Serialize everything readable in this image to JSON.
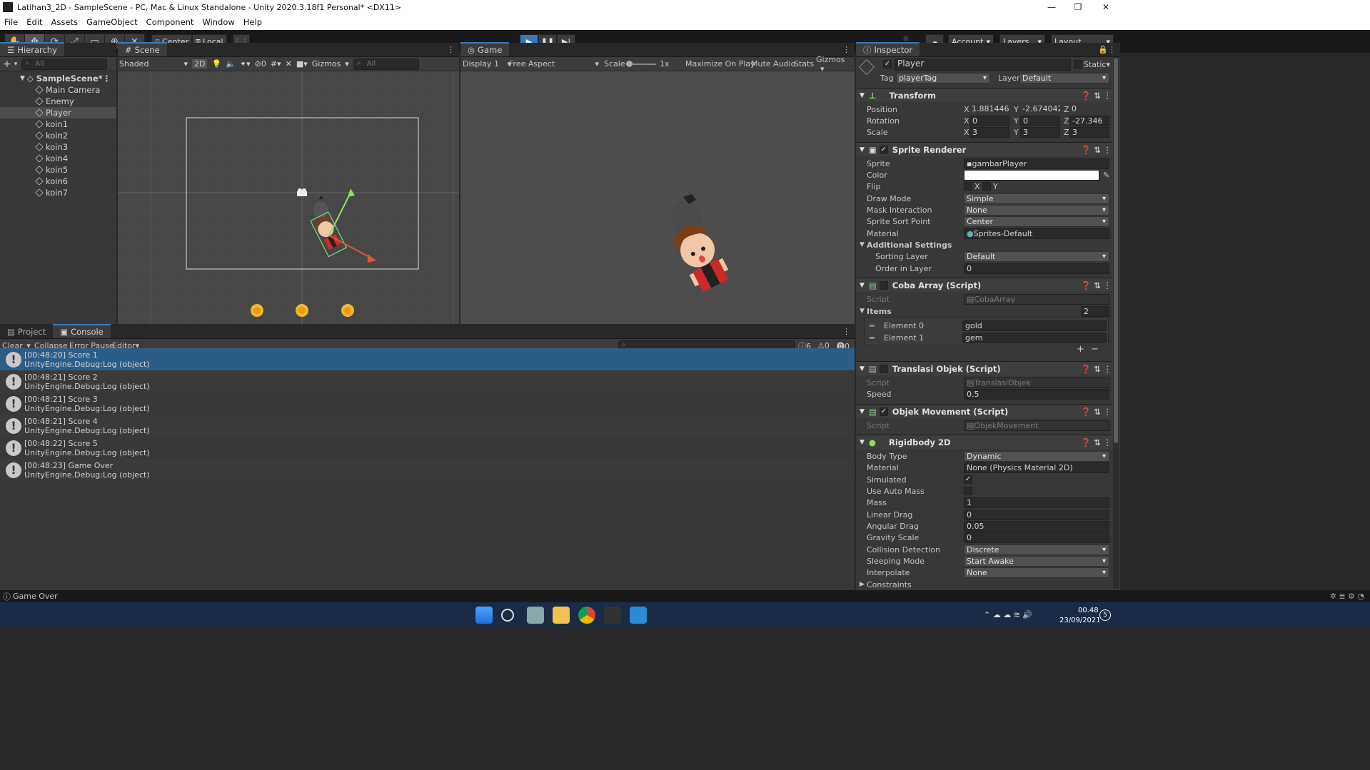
{
  "window": {
    "title": "Latihan3_2D - SampleScene - PC, Mac & Linux Standalone - Unity 2020.3.18f1 Personal* <DX11>",
    "min": "—",
    "max": "❐",
    "close": "✕"
  },
  "menu": [
    "File",
    "Edit",
    "Assets",
    "GameObject",
    "Component",
    "Window",
    "Help"
  ],
  "toolbar": {
    "pivot": "Center",
    "space": "Local",
    "account": "Account",
    "layers": "Layers",
    "layout": "Layout"
  },
  "hierarchy": {
    "tab": "Hierarchy",
    "plus": "+",
    "search": "All",
    "scene": "SampleScene*",
    "items": [
      "Main Camera",
      "Enemy",
      "Player",
      "koin1",
      "koin2",
      "koin3",
      "koin4",
      "koin5",
      "koin6",
      "koin7"
    ],
    "selected": "Player"
  },
  "scene": {
    "tab": "Scene",
    "shading": "Shaded",
    "mode2d": "2D",
    "hidden_count": "0",
    "gizmos": "Gizmos",
    "search": "All"
  },
  "game": {
    "tab": "Game",
    "display": "Display 1",
    "aspect": "Free Aspect",
    "scale_label": "Scale",
    "scale_value": "1x",
    "maximize": "Maximize On Play",
    "mute": "Mute Audio",
    "stats": "Stats",
    "gizmos": "Gizmos"
  },
  "bottom": {
    "tab_project": "Project",
    "tab_console": "Console",
    "clear": "Clear",
    "collapse": "Collapse",
    "error_pause": "Error Pause",
    "editor": "Editor",
    "log_count": "6",
    "warn_count": "0",
    "err_count": "0"
  },
  "console": [
    {
      "time_msg": "[00:48:20] Score 1",
      "src": "UnityEngine.Debug:Log (object)"
    },
    {
      "time_msg": "[00:48:21] Score 2",
      "src": "UnityEngine.Debug:Log (object)"
    },
    {
      "time_msg": "[00:48:21] Score 3",
      "src": "UnityEngine.Debug:Log (object)"
    },
    {
      "time_msg": "[00:48:21] Score 4",
      "src": "UnityEngine.Debug:Log (object)"
    },
    {
      "time_msg": "[00:48:22] Score 5",
      "src": "UnityEngine.Debug:Log (object)"
    },
    {
      "time_msg": "[00:48:23] Game Over",
      "src": "UnityEngine.Debug:Log (object)"
    }
  ],
  "statusbar": "Game Over",
  "inspector": {
    "tab": "Inspector",
    "object_name": "Player",
    "static": "Static",
    "tag_label": "Tag",
    "tag": "playerTag",
    "layer_label": "Layer",
    "layer": "Default",
    "transform": {
      "title": "Transform",
      "position_label": "Position",
      "rotation_label": "Rotation",
      "scale_label": "Scale",
      "pos": [
        "1.881446",
        "-2.674042",
        "0"
      ],
      "rot": [
        "0",
        "0",
        "-27.346"
      ],
      "scl": [
        "3",
        "3",
        "3"
      ]
    },
    "sprite_renderer": {
      "title": "Sprite Renderer",
      "sprite_label": "Sprite",
      "sprite": "gambarPlayer",
      "color_label": "Color",
      "flip_label": "Flip",
      "flip_x": "X",
      "flip_y": "Y",
      "draw_mode_label": "Draw Mode",
      "draw_mode": "Simple",
      "mask_label": "Mask Interaction",
      "mask": "None",
      "sort_point_label": "Sprite Sort Point",
      "sort_point": "Center",
      "material_label": "Material",
      "material": "Sprites-Default",
      "additional": "Additional Settings",
      "sorting_layer_label": "Sorting Layer",
      "sorting_layer": "Default",
      "order_label": "Order in Layer",
      "order": "0"
    },
    "coba_array": {
      "title": "Coba Array (Script)",
      "script_label": "Script",
      "script": "CobaArray",
      "items_label": "Items",
      "items_count": "2",
      "el0_label": "Element 0",
      "el0": "gold",
      "el1_label": "Element 1",
      "el1": "gem",
      "plus": "+",
      "minus": "−"
    },
    "translasi": {
      "title": "Translasi Objek (Script)",
      "script_label": "Script",
      "script": "TranslasiObjek",
      "speed_label": "Speed",
      "speed": "0.5"
    },
    "movement": {
      "title": "Objek Movement (Script)",
      "script_label": "Script",
      "script": "ObjekMovement"
    },
    "rigidbody": {
      "title": "Rigidbody 2D",
      "body_type_label": "Body Type",
      "body_type": "Dynamic",
      "material_label": "Material",
      "material": "None (Physics Material 2D)",
      "simulated_label": "Simulated",
      "auto_mass_label": "Use Auto Mass",
      "mass_label": "Mass",
      "mass": "1",
      "linear_label": "Linear Drag",
      "linear": "0",
      "angular_label": "Angular Drag",
      "angular": "0.05",
      "gravity_label": "Gravity Scale",
      "gravity": "0",
      "collision_label": "Collision Detection",
      "collision": "Discrete",
      "sleeping_label": "Sleeping Mode",
      "sleeping": "Start Awake",
      "interpolate_label": "Interpolate",
      "interpolate": "None",
      "constraints_label": "Constraints"
    }
  },
  "taskbar": {
    "time": "00.48",
    "date": "23/09/2021",
    "badge": "5"
  },
  "colors": {
    "accent": "#3a79bb",
    "selected_row": "#2c5d87",
    "scene_bg": "#474747",
    "game_bg": "#4d4d4d",
    "taskbar": "#1b2b45"
  }
}
